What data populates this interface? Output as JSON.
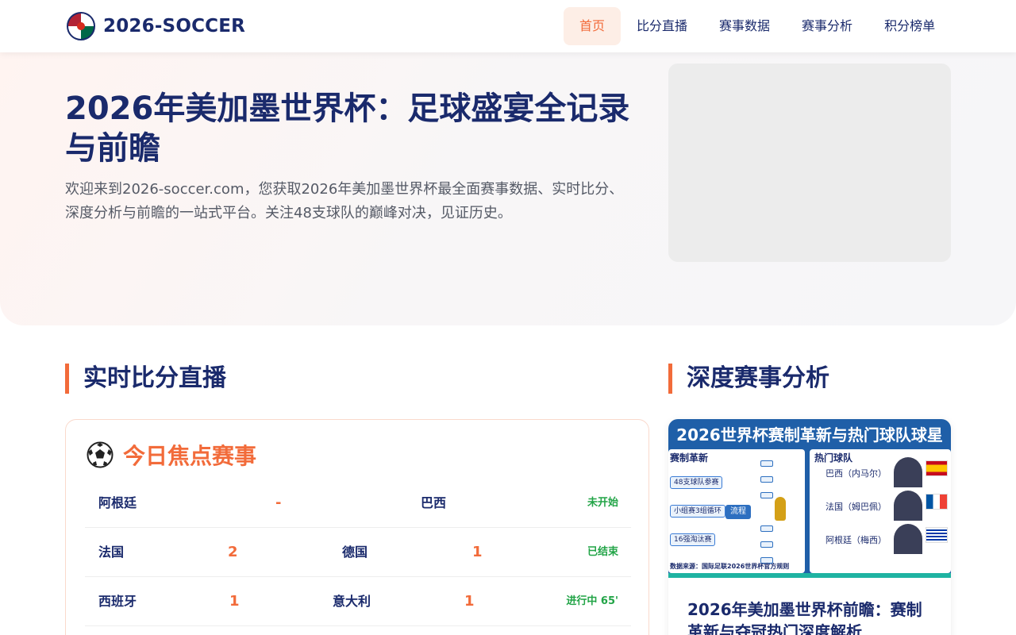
{
  "header": {
    "logo_text": "2026-SOCCER",
    "nav": [
      {
        "label": "首页",
        "active": true
      },
      {
        "label": "比分直播",
        "active": false
      },
      {
        "label": "赛事数据",
        "active": false
      },
      {
        "label": "赛事分析",
        "active": false
      },
      {
        "label": "积分榜单",
        "active": false
      }
    ]
  },
  "hero": {
    "title": "2026年美加墨世界杯：足球盛宴全记录与前瞻",
    "description": "欢迎来到2026-soccer.com，您获取2026年美加墨世界杯最全面赛事数据、实时比分、深度分析与前瞻的一站式平台。关注48支球队的巅峰对决，见证历史。"
  },
  "live": {
    "section_title": "实时比分直播",
    "card_title": "今日焦点赛事",
    "matches": [
      {
        "team_a": "阿根廷",
        "score_a": "-",
        "team_b": "巴西",
        "score_b": "",
        "status": "未开始"
      },
      {
        "team_a": "法国",
        "score_a": "2",
        "team_b": "德国",
        "score_b": "1",
        "status": "已结束"
      },
      {
        "team_a": "西班牙",
        "score_a": "1",
        "team_b": "意大利",
        "score_b": "1",
        "status": "进行中 65'"
      }
    ]
  },
  "analysis": {
    "section_title": "深度赛事分析",
    "thumbnail": {
      "title": "2026世界杯赛制革新与热门球队球星",
      "left_heading": "赛制革新",
      "right_heading": "热门球队",
      "items": [
        "48支球队参赛",
        "小组赛3组循环",
        "16强淘汰赛"
      ],
      "flow_label": "流程",
      "teams": [
        "巴西（内马尔）",
        "法国（姆巴佩）",
        "阿根廷（梅西）"
      ],
      "source": "数据来源：国际足联2026世界杯官方规则"
    },
    "article_title": "2026年美加墨世界杯前瞻：赛制革新与夺冠热门深度解析"
  },
  "colors": {
    "primary": "#1a2a6c",
    "accent": "#f26b3a",
    "status_green": "#22a447"
  }
}
